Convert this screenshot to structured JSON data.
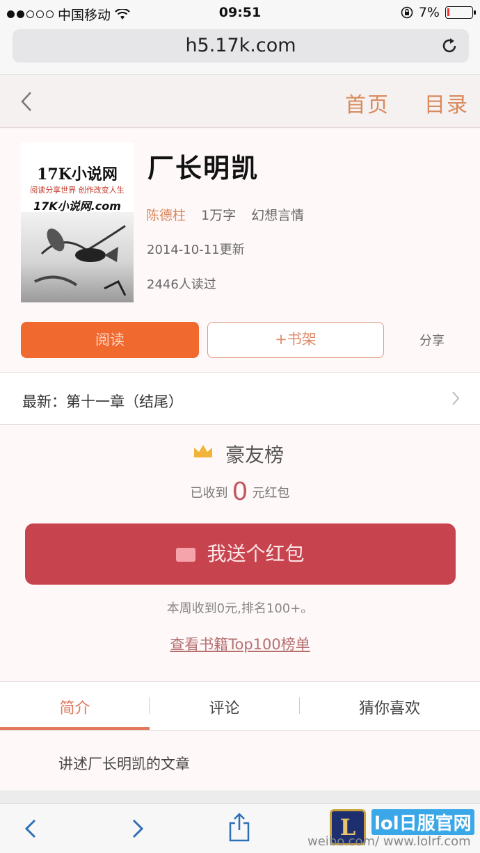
{
  "status_bar": {
    "carrier": "中国移动",
    "time": "09:51",
    "battery": "7%"
  },
  "browser": {
    "url": "h5.17k.com"
  },
  "nav": {
    "home": "首页",
    "toc": "目录"
  },
  "book": {
    "cover": {
      "title": "17K小说网",
      "subtitle": "阅读分享世界 创作改变人生",
      "logo": "17K小说网.com"
    },
    "title": "厂长明凯",
    "author": "陈德柱",
    "word_count": "1万字",
    "genre": "幻想言情",
    "updated": "2014-10-11更新",
    "readers": "2446人读过"
  },
  "actions": {
    "read": "阅读",
    "add_shelf": "+书架",
    "share": "分享"
  },
  "latest": {
    "label": "最新：第十一章（结尾）"
  },
  "rank": {
    "title": "豪友榜",
    "received_prefix": "已收到",
    "received_amount": "0",
    "received_suffix": "元红包",
    "send_button": "我送个红包",
    "weekly": "本周收到0元,排名100+。",
    "top_link": "查看书籍Top100榜单"
  },
  "tabs": [
    {
      "label": "简介",
      "active": true
    },
    {
      "label": "评论",
      "active": false
    },
    {
      "label": "猜你喜欢",
      "active": false
    }
  ],
  "intro": {
    "text": "讲述厂长明凯的文章"
  },
  "watermark": {
    "logo": "L",
    "site": "lol日服官网",
    "sub": "weibo.com/ www.lolrf.com"
  },
  "colors": {
    "accent": "#f0692e",
    "red_button": "#c7434d",
    "link": "#d98a5c"
  }
}
